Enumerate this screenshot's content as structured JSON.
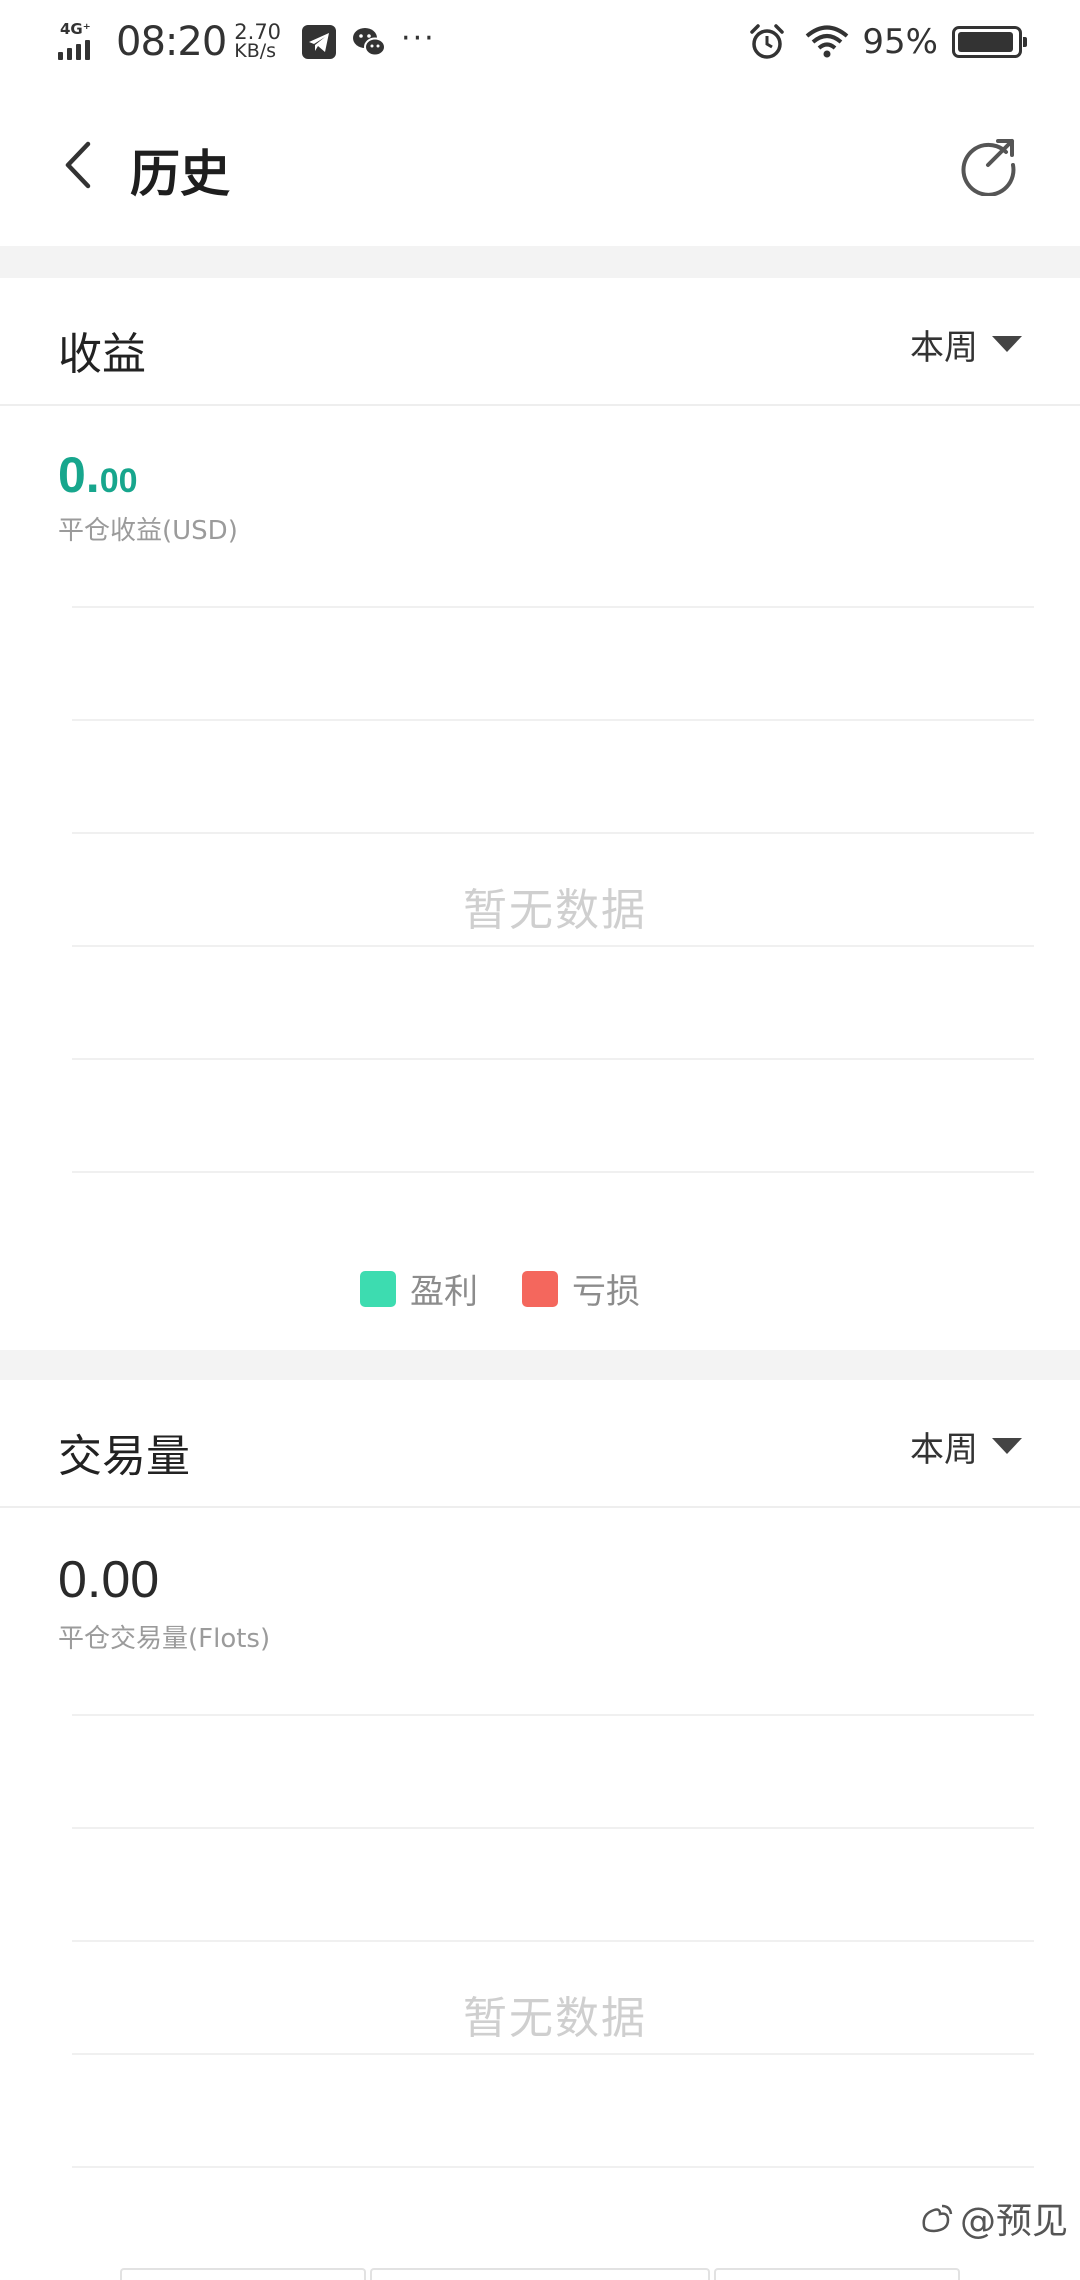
{
  "status_bar": {
    "network": "4G⁺",
    "time": "08:20",
    "speed_value": "2.70",
    "speed_unit": "KB/s",
    "more": "···",
    "battery_percent_text": "95%",
    "battery_level": 0.95,
    "icons": [
      "signal-icon",
      "telegram-icon",
      "wechat-icon",
      "alarm-icon",
      "wifi-icon",
      "battery-icon"
    ]
  },
  "header": {
    "title": "历史",
    "back_icon": "chevron-left-icon",
    "share_icon": "share-icon"
  },
  "profit_card": {
    "title": "收益",
    "period": "本周",
    "value_int": "0.",
    "value_dec": "00",
    "caption": "平仓收益(USD)",
    "empty_text": "暂无数据",
    "legend": [
      {
        "label": "盈利",
        "color": "#3ddcb0"
      },
      {
        "label": "亏损",
        "color": "#f4675d"
      }
    ]
  },
  "volume_card": {
    "title": "交易量",
    "period": "本周",
    "value": "0.00",
    "caption": "平仓交易量(Flots)",
    "empty_text": "暂无数据"
  },
  "watermark": {
    "text": "@预见"
  },
  "colors": {
    "profit_value": "#17a68d",
    "gain": "#3ddcb0",
    "loss": "#f4675d",
    "divider": "#f3f3f3"
  }
}
